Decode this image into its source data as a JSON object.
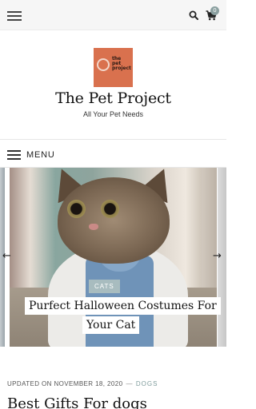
{
  "header": {
    "cart_count": "0",
    "menu_icon": "hamburger-icon",
    "search_icon": "search-icon",
    "cart_icon": "cart-icon"
  },
  "brand": {
    "logo_text": [
      "the",
      "pet",
      "project"
    ],
    "logo_color": "#d9714e",
    "site_title": "The Pet Project",
    "tagline": "All Your Pet Needs"
  },
  "nav": {
    "menu_label": "MENU"
  },
  "slider": {
    "current_slide": {
      "category": "CATS",
      "title_line_1": "Purfect Halloween Costumes For",
      "title_line_2": "Your Cat"
    },
    "prev_arrow": "←",
    "next_arrow": "→"
  },
  "latest_post": {
    "updated": "UPDATED ON NOVEMBER 18, 2020",
    "separator": "—",
    "category": "DOGS",
    "title": "Best Gifts For dogs"
  },
  "colors": {
    "accent": "#7e9b9b",
    "badge": "#8ba0a0",
    "chip": "#a8bcbf"
  }
}
